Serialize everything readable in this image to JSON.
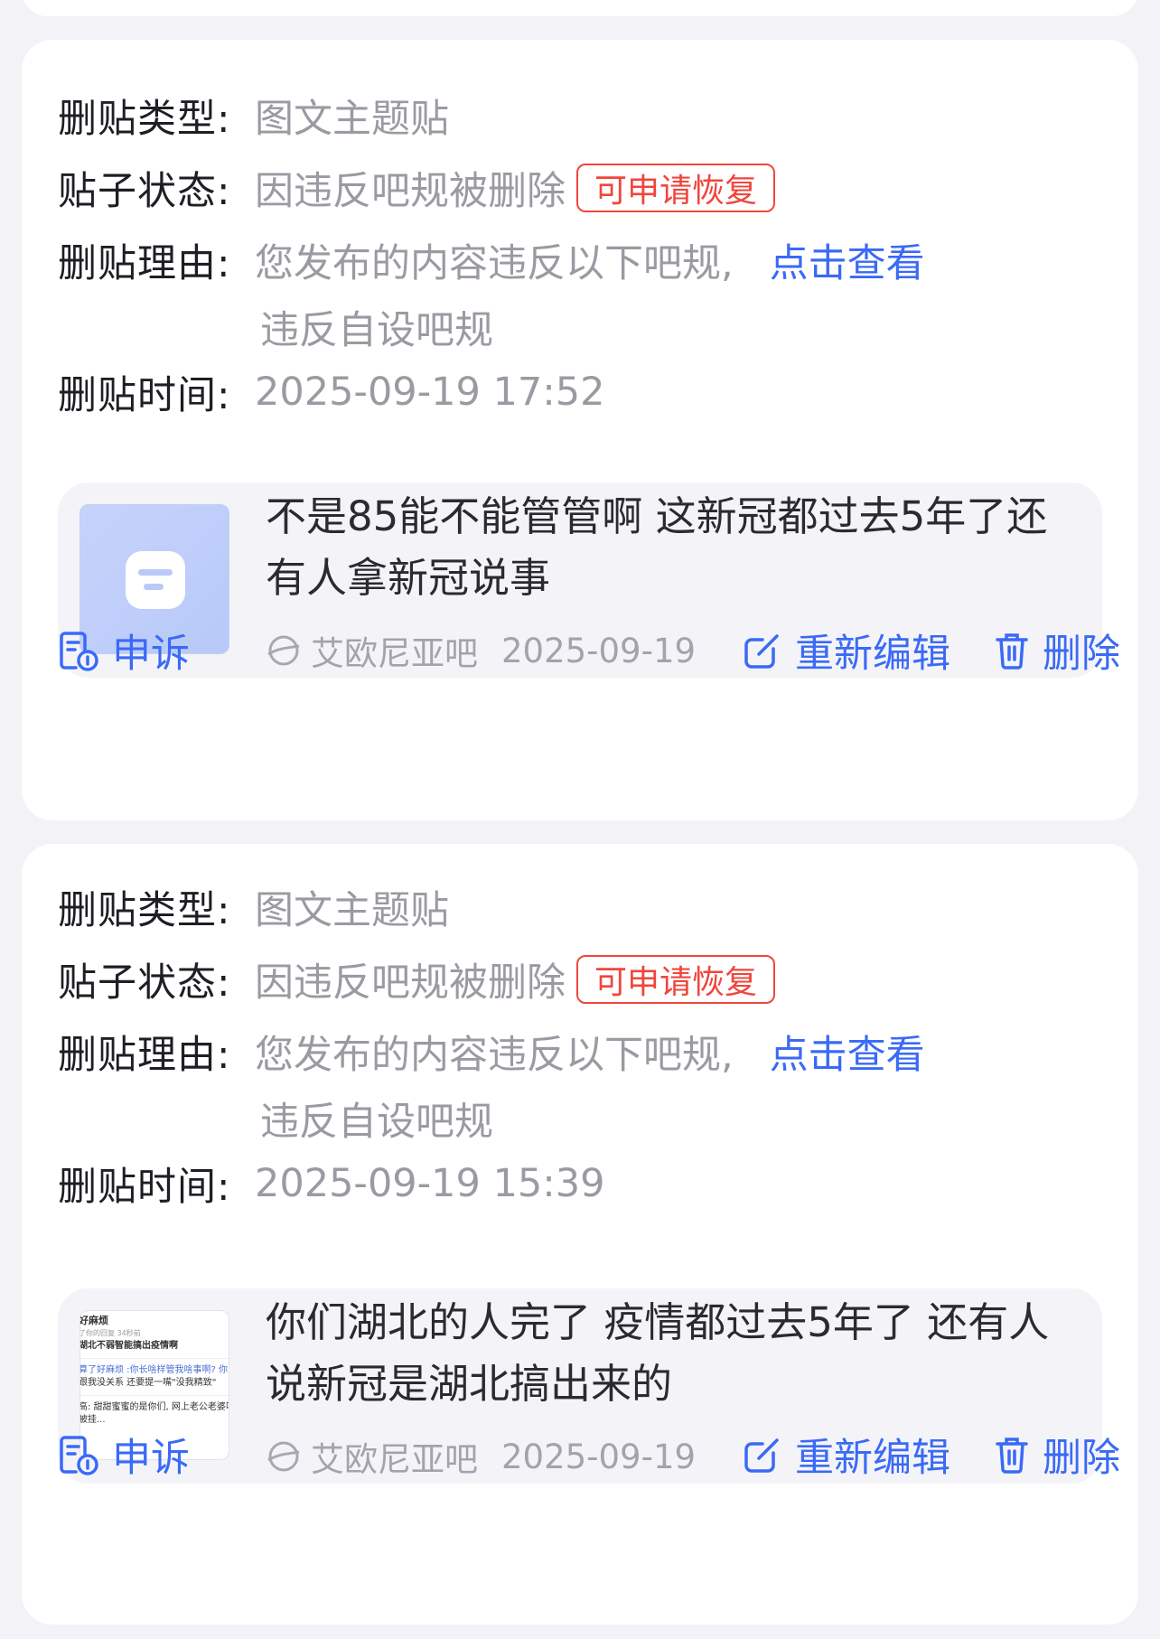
{
  "labels": {
    "type": "删贴类型:",
    "status": "贴子状态:",
    "reason": "删贴理由:",
    "time": "删贴时间:"
  },
  "cards": [
    {
      "type_value": "图文主题贴",
      "status_value": "因违反吧规被删除",
      "status_badge": "可申请恢复",
      "reason_text": "您发布的内容违反以下吧规,",
      "reason_link": "点击查看",
      "reason_detail": "违反自设吧规",
      "time_value": "2025-09-19 17:52",
      "post": {
        "title": "不是85能不能管管啊 这新冠都过去5年了还有人拿新冠说事",
        "forum": "艾欧尼亚吧",
        "date": "2025-09-19",
        "thumb_icon": "tieba-logo-icon"
      },
      "actions": {
        "appeal": "申诉",
        "edit": "重新编辑",
        "delete": "删除"
      }
    },
    {
      "type_value": "图文主题贴",
      "status_value": "因违反吧规被删除",
      "status_badge": "可申请恢复",
      "reason_text": "您发布的内容违反以下吧规,",
      "reason_link": "点击查看",
      "reason_detail": "违反自设吧规",
      "time_value": "2025-09-19 15:39",
      "post": {
        "title": "你们湖北的人完了 疫情都过去5年了 还有人说新冠是湖北搞出来的",
        "forum": "艾欧尼亚吧",
        "date": "2025-09-19",
        "thumb_lines": [
          "好麻烦",
          "了你的回复 34秒前",
          "湖北不弱智能搞出疫情啊",
          "算了好麻烦 :你长啥样管我啥事啊? 你",
          "跟我没关系 还要提一嘴\"没我精致\"",
          "高: 甜甜蜜蜜的是你们, 网上老公老婆叫",
          "被挂..."
        ]
      },
      "actions": {
        "appeal": "申诉",
        "edit": "重新编辑",
        "delete": "删除"
      }
    }
  ],
  "colors": {
    "accent_blue": "#3a6af6",
    "badge_red": "#f0463c",
    "muted_text": "#9a9aa2",
    "background": "#f3f3f7"
  }
}
